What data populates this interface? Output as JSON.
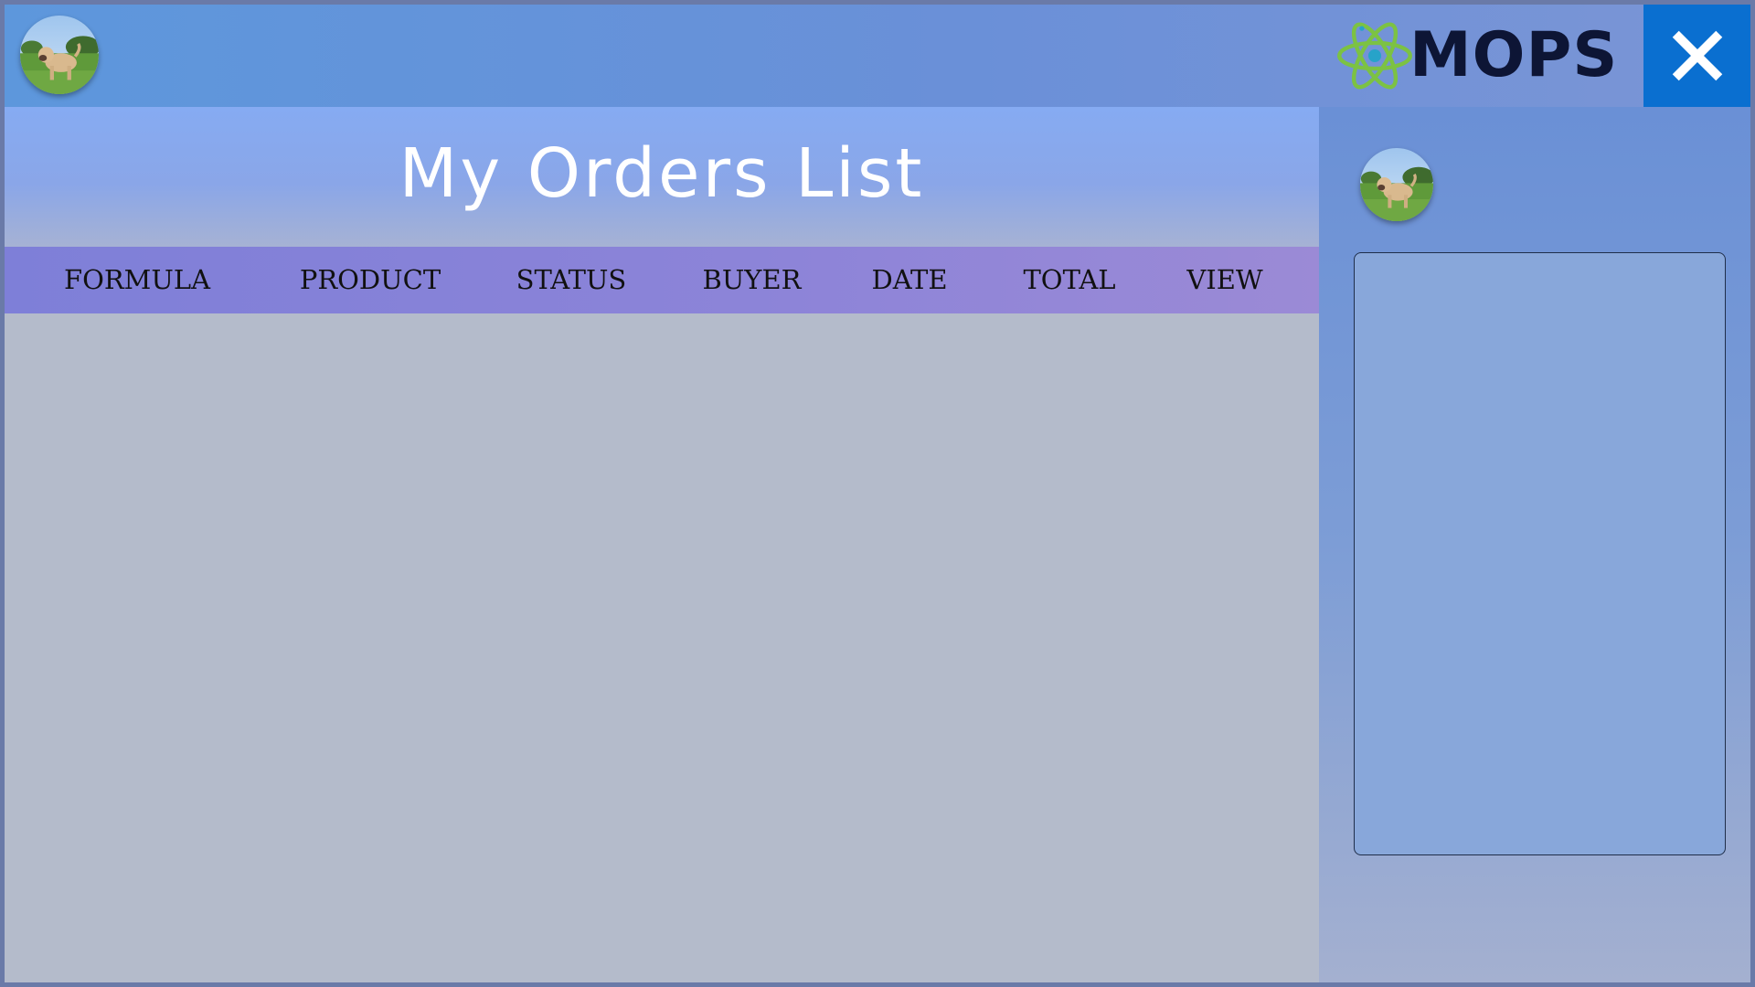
{
  "header": {
    "brand": "MOPS",
    "avatar_icon": "dog-avatar-icon",
    "logo_icon": "atom-icon",
    "close_icon": "close-icon"
  },
  "page": {
    "title": "My Orders List"
  },
  "table": {
    "columns": [
      "FORMULA",
      "PRODUCT",
      "STATUS",
      "BUYER",
      "DATE",
      "TOTAL",
      "VIEW"
    ],
    "rows": []
  },
  "sidebar": {
    "avatar_icon": "dog-avatar-icon"
  },
  "colors": {
    "header_bg": "#6a90d8",
    "close_bg": "#0a6fd0",
    "column_header_bg": "#8d84d8",
    "body_bg": "#b4bbcb",
    "panel_bg": "#88a7da"
  }
}
